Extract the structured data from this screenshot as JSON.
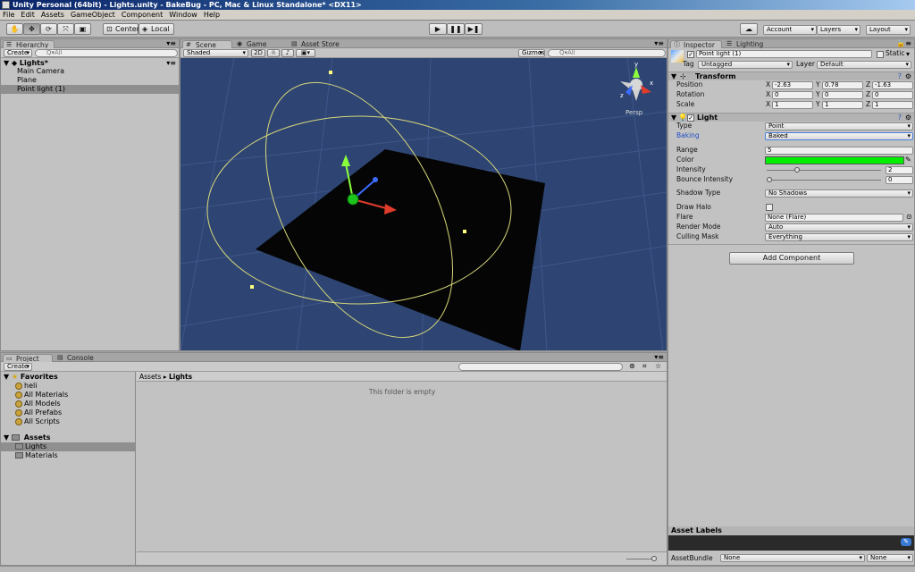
{
  "window": {
    "title": "Unity Personal (64bit) - Lights.unity - BakeBug - PC, Mac & Linux Standalone* <DX11>"
  },
  "menu": [
    "File",
    "Edit",
    "Assets",
    "GameObject",
    "Component",
    "Window",
    "Help"
  ],
  "toolbar": {
    "pivot_center": "Center",
    "pivot_local": "Local",
    "account": "Account",
    "layers": "Layers",
    "layout": "Layout"
  },
  "hierarchy": {
    "tab": "Hierarchy",
    "create": "Create",
    "search_placeholder": "Q▾All",
    "scene": "Lights*",
    "items": [
      "Main Camera",
      "Plane",
      "Point light (1)"
    ]
  },
  "scene_view": {
    "tabs": [
      "Scene",
      "Game",
      "Asset Store"
    ],
    "shading": "Shaded",
    "mode_2d": "2D",
    "gizmos": "Gizmos",
    "search_placeholder": "Q▾All",
    "persp": "Persp",
    "gizmo_axes": {
      "y": "y",
      "x": "x",
      "z": "z"
    }
  },
  "inspector": {
    "tabs": [
      "Inspector",
      "Lighting"
    ],
    "object_name": "Point light (1)",
    "static_label": "Static",
    "tag_label": "Tag",
    "tag_value": "Untagged",
    "layer_label": "Layer",
    "layer_value": "Default",
    "transform": {
      "title": "Transform",
      "position_label": "Position",
      "rotation_label": "Rotation",
      "scale_label": "Scale",
      "axis_x": "X",
      "axis_y": "Y",
      "axis_z": "Z",
      "position": [
        "-2.63",
        "0.78",
        "-1.63"
      ],
      "rotation": [
        "0",
        "0",
        "0"
      ],
      "scale": [
        "1",
        "1",
        "1"
      ]
    },
    "light": {
      "title": "Light",
      "type_label": "Type",
      "type_value": "Point",
      "baking_label": "Baking",
      "baking_value": "Baked",
      "range_label": "Range",
      "range_value": "5",
      "color_label": "Color",
      "color_value": "#00ee00",
      "intensity_label": "Intensity",
      "intensity_value": "2",
      "intensity_fraction": 0.25,
      "bounce_label": "Bounce Intensity",
      "bounce_value": "0",
      "bounce_fraction": 0.0,
      "shadow_label": "Shadow Type",
      "shadow_value": "No Shadows",
      "halo_label": "Draw Halo",
      "flare_label": "Flare",
      "flare_value": "None (Flare)",
      "render_label": "Render Mode",
      "render_value": "Auto",
      "culling_label": "Culling Mask",
      "culling_value": "Everything"
    },
    "add_component": "Add Component",
    "asset_labels": "Asset Labels",
    "asset_bundle_label": "AssetBundle",
    "asset_bundle_value": "None",
    "asset_bundle_variant": "None"
  },
  "project": {
    "tabs": [
      "Project",
      "Console"
    ],
    "create": "Create",
    "favorites_title": "Favorites",
    "favorites": [
      "heli",
      "All Materials",
      "All Models",
      "All Prefabs",
      "All Scripts"
    ],
    "assets_title": "Assets",
    "asset_folders": [
      "Lights",
      "Materials"
    ],
    "breadcrumb_root": "Assets",
    "breadcrumb_current": "Lights",
    "empty_message": "This folder is empty"
  }
}
